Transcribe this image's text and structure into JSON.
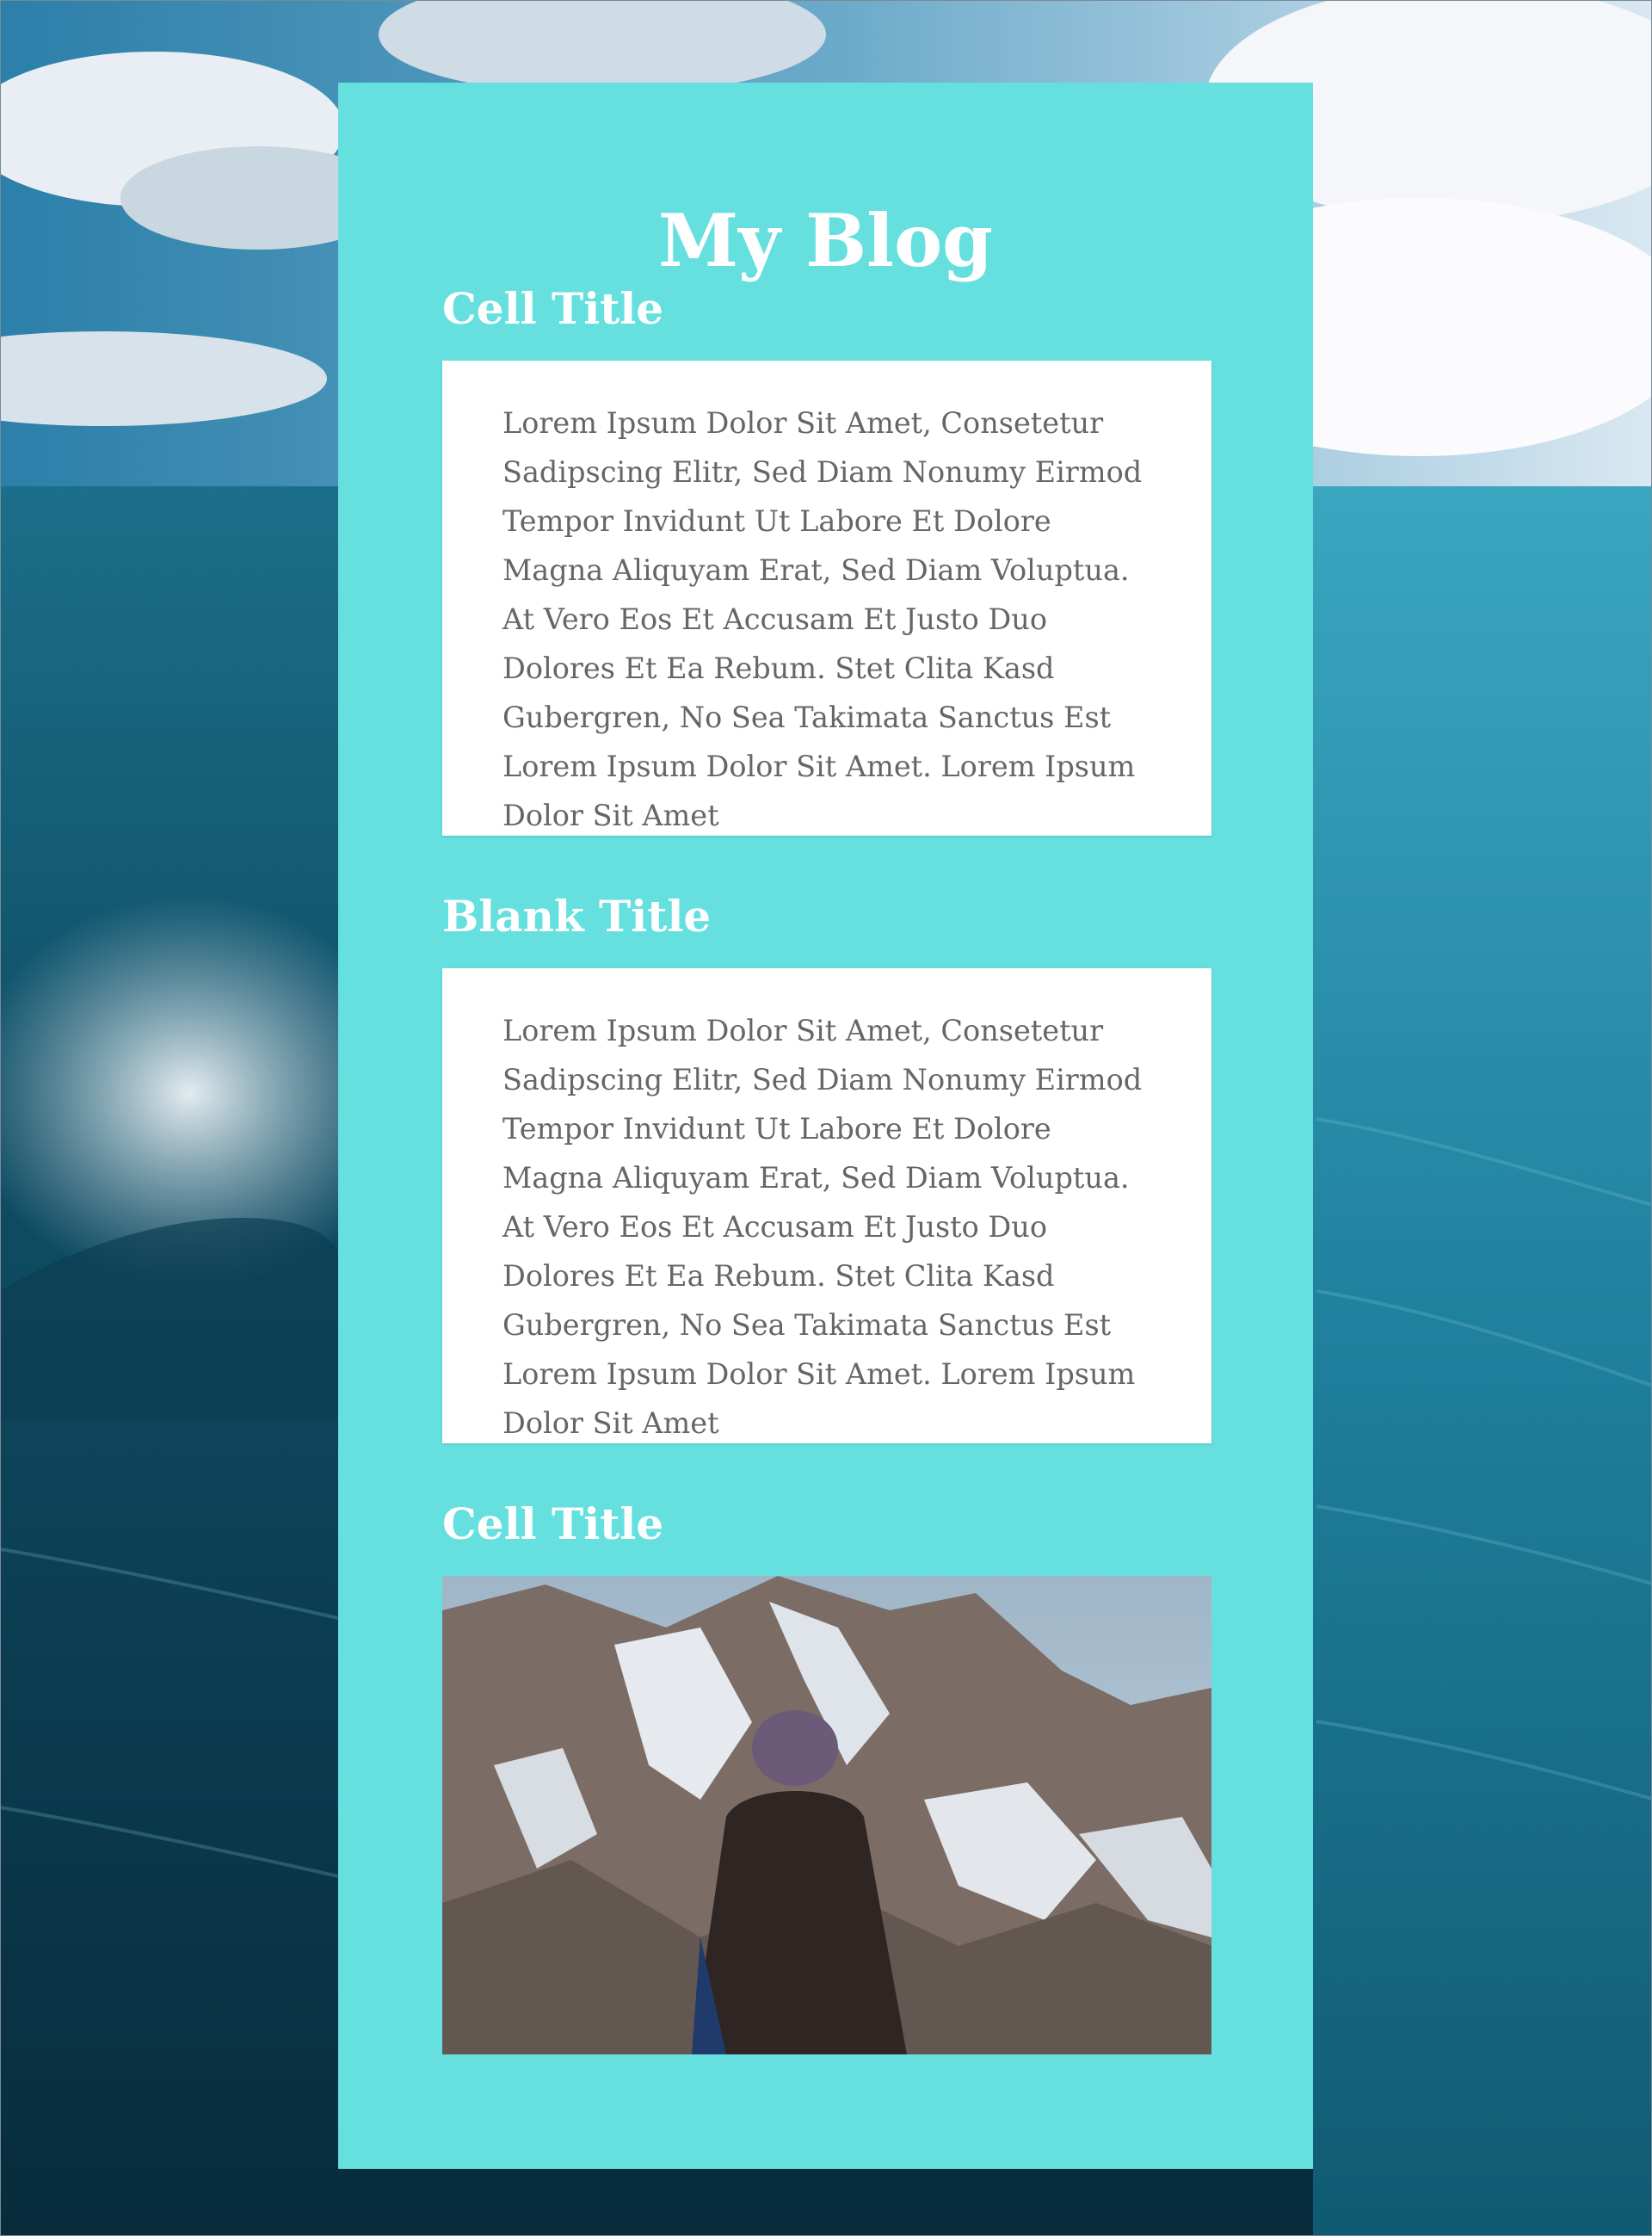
{
  "page": {
    "title": "My Blog"
  },
  "colors": {
    "panel": "#66e0df",
    "heading_text": "#ffffff",
    "card_background": "#ffffff",
    "body_text": "#666666"
  },
  "background": {
    "description_icon": "ocean-wave-background-image"
  },
  "sections": [
    {
      "title": "Cell Title",
      "type": "text",
      "body": "Lorem Ipsum Dolor Sit Amet, Consetetur Sadipscing Elitr, Sed Diam Nonumy Eirmod Tempor Invidunt Ut Labore Et Dolore Magna Aliquyam Erat, Sed Diam Voluptua. At Vero Eos Et Accusam Et Justo Duo Dolores Et Ea Rebum. Stet Clita Kasd Gubergren, No Sea Takimata Sanctus Est Lorem Ipsum Dolor Sit Amet. Lorem Ipsum Dolor Sit Amet"
    },
    {
      "title": "Blank Title",
      "type": "text",
      "body": "Lorem Ipsum Dolor Sit Amet, Consetetur Sadipscing Elitr, Sed Diam Nonumy Eirmod Tempor Invidunt Ut Labore Et Dolore Magna Aliquyam Erat, Sed Diam Voluptua. At Vero Eos Et Accusam Et Justo Duo Dolores Et Ea Rebum. Stet Clita Kasd Gubergren, No Sea Takimata Sanctus Est Lorem Ipsum Dolor Sit Amet. Lorem Ipsum Dolor Sit Amet"
    },
    {
      "title": "Cell Title",
      "type": "image",
      "image_icon": "mountain-hiker-photo"
    }
  ]
}
